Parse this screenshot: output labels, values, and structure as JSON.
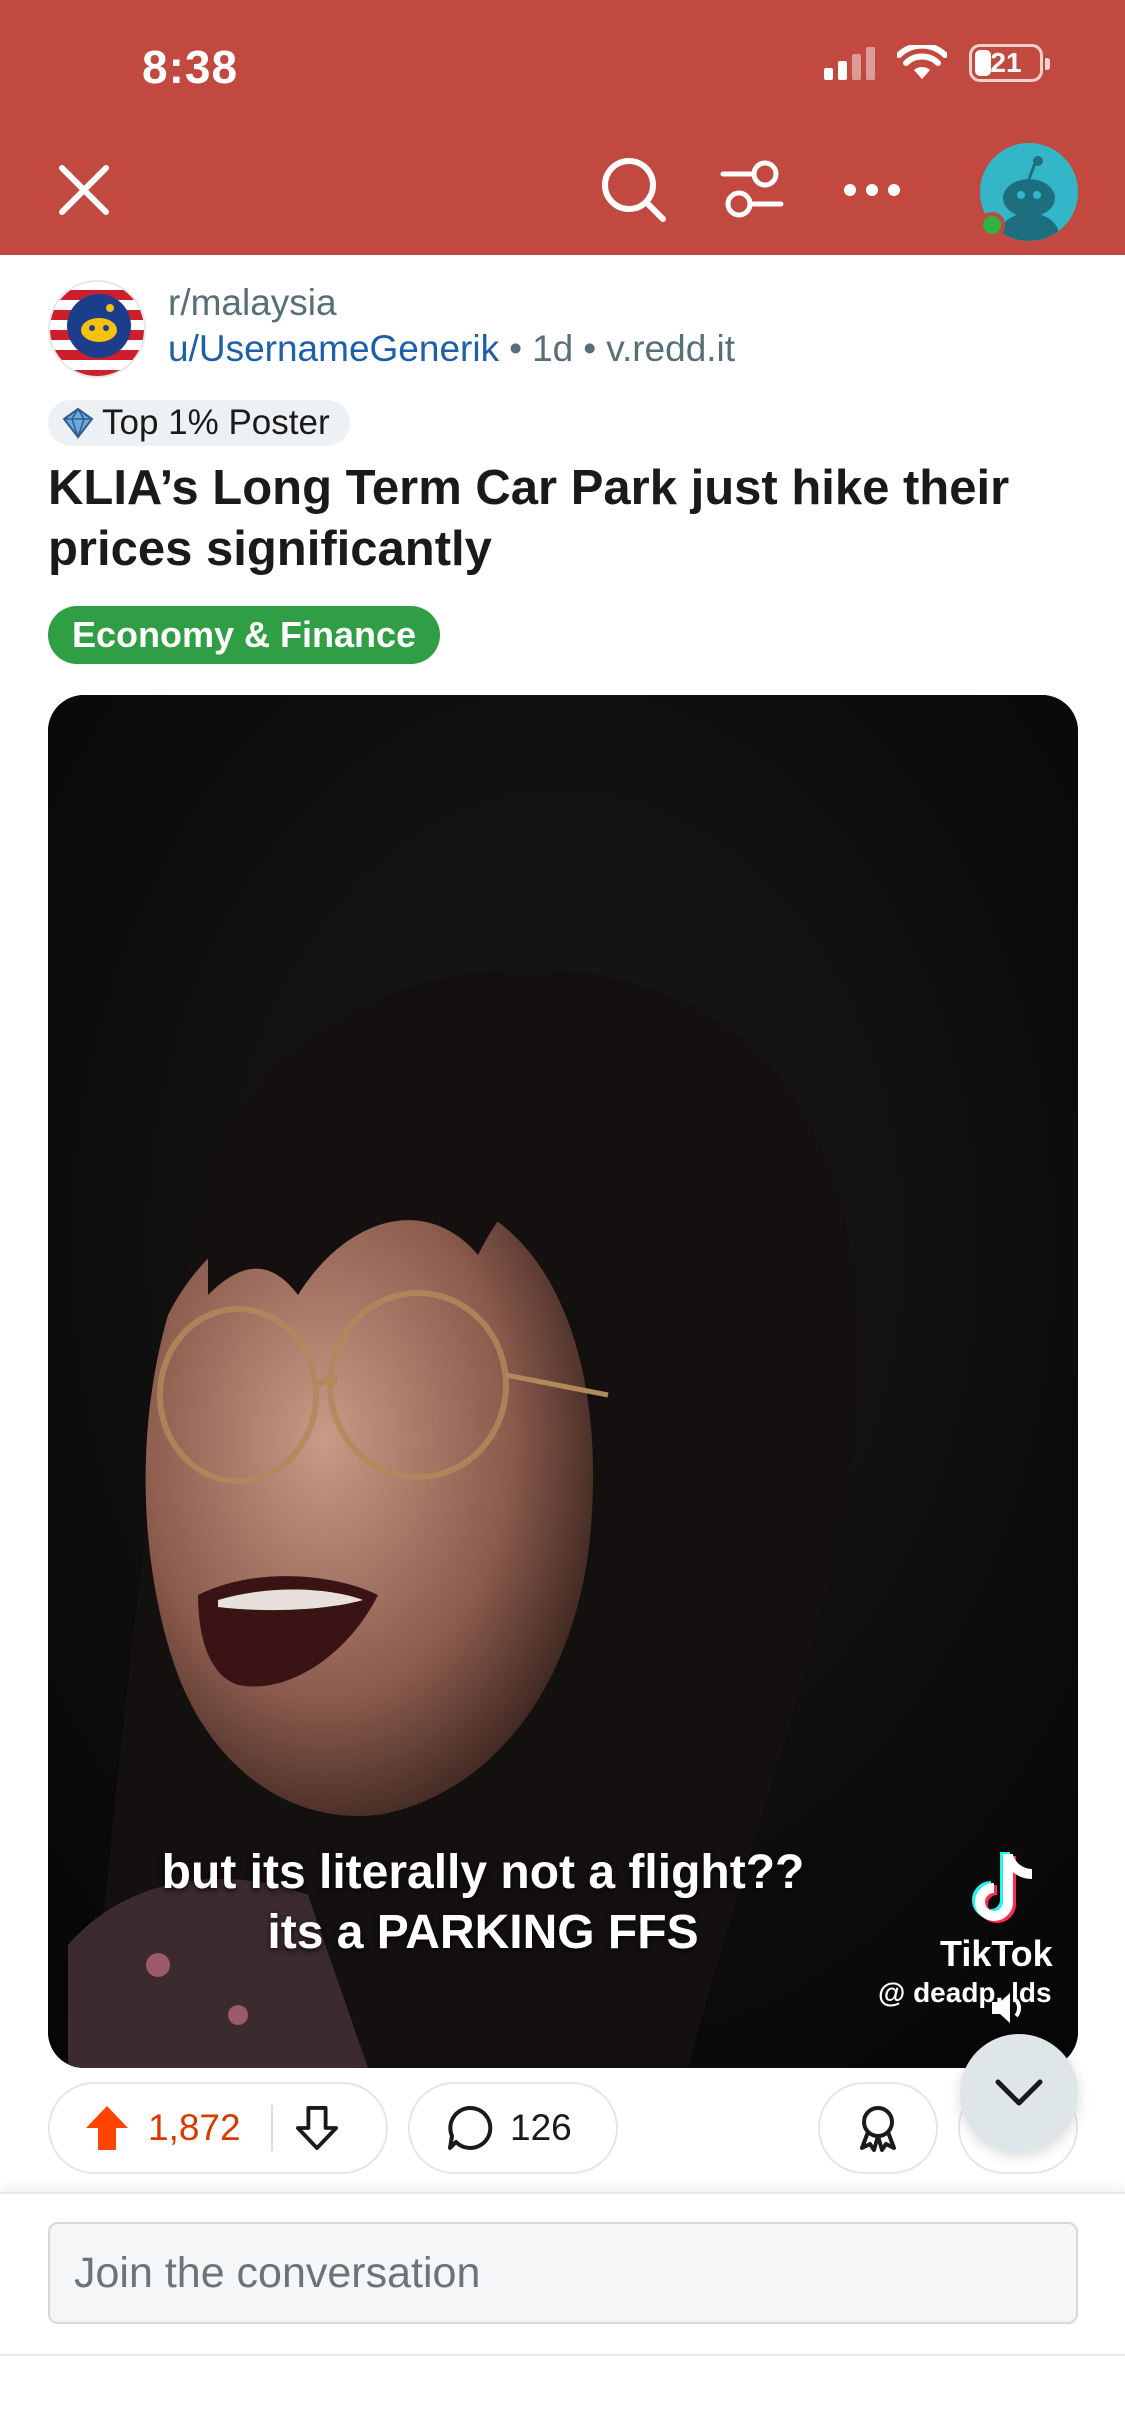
{
  "status_bar": {
    "time": "8:38",
    "battery": "21"
  },
  "nav": {
    "close_icon": "close-icon",
    "search_icon": "search-icon",
    "filter_icon": "filter-icon",
    "more_icon": "more-icon"
  },
  "post": {
    "subreddit": "r/malaysia",
    "author": "u/UsernameGenerik",
    "age": "1d",
    "domain": "v.redd.it",
    "badge": "Top 1% Poster",
    "title": "KLIA’s Long Term Car Park just hike their prices significantly",
    "flair": "Economy & Finance",
    "flair_color": "#2f9e44"
  },
  "video": {
    "caption_line1": "but its literally not a flight??",
    "caption_line2": "its a PARKING FFS",
    "watermark_name": "TikTok",
    "watermark_handle": "@ deadp..lds"
  },
  "actions": {
    "upvotes": "1,872",
    "comments": "126"
  },
  "compose": {
    "placeholder": "Join the conversation"
  },
  "colors": {
    "header": "#c2493f",
    "upvote": "#ff4500",
    "vote_count": "#d93a00",
    "link": "#1d5fa8"
  }
}
